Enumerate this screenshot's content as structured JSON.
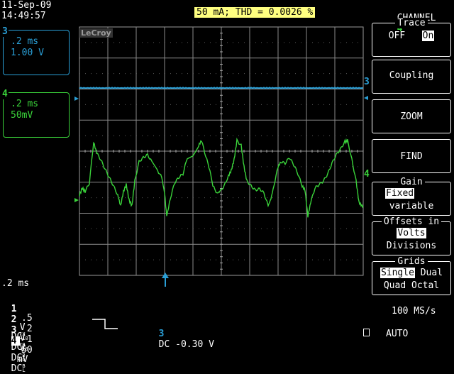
{
  "header": {
    "date": "11-Sep-09",
    "time": "14:49:57",
    "measurement": "50 mA; THD = 0.0026 %",
    "channel_label": "CHANNEL",
    "channel_number": "4"
  },
  "logo": "LeCroy",
  "channel_boxes": [
    {
      "id": "3",
      "timebase": ".2 ms",
      "scale": "1.00 V",
      "color": "#2a9fd6"
    },
    {
      "id": "4",
      "timebase": ".2 ms",
      "scale": "50mV",
      "color": "#3ad33a"
    }
  ],
  "markers": {
    "ch3": "3",
    "ch4": "4"
  },
  "menu": {
    "trace": {
      "head": "Trace",
      "off": "OFF",
      "on": "On"
    },
    "coupling": "Coupling",
    "zoom": "ZOOM",
    "find": "FIND",
    "gain": {
      "head": "Gain",
      "fixed": "Fixed",
      "variable": "variable"
    },
    "offsets": {
      "head": "Offsets in",
      "volts": "Volts",
      "divisions": "Divisions"
    },
    "grids": {
      "head": "Grids",
      "single": "Single",
      "dual": "Dual",
      "quad": "Quad",
      "octal": "Octal"
    }
  },
  "bottom": {
    "timebase": ".2 ms",
    "channels": [
      {
        "num": "1",
        "value": ".5",
        "unit": "V",
        "coupling": "DC",
        "sub_top": "X",
        "sub_bot": "10"
      },
      {
        "num": "2",
        "value": "2",
        "unit": "V",
        "coupling": "DC",
        "sub_top": "B",
        "sub_bot": "10"
      },
      {
        "num": "3",
        "value": "1",
        "unit": "V",
        "coupling": "DC",
        "sub_top": "B",
        "sub_bot": "L"
      },
      {
        "num": "4",
        "value": "50",
        "unit": "mV",
        "coupling": "DC",
        "sub_top": "B",
        "sub_bot": "L"
      }
    ],
    "trigger_channel": "3",
    "trigger_text": "DC -0.30 V",
    "sample_rate": "100 MS/s",
    "mode": "AUTO",
    "mode_icon": "square-icon"
  },
  "colors": {
    "ch3": "#2a9fd6",
    "ch4": "#3ad33a",
    "grid": "#ffffff"
  }
}
